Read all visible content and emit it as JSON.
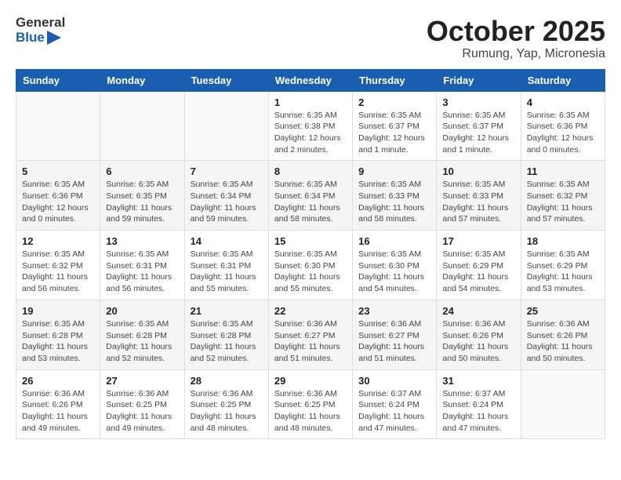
{
  "logo": {
    "text_general": "General",
    "text_blue": "Blue"
  },
  "title": {
    "month": "October 2025",
    "location": "Rumung, Yap, Micronesia"
  },
  "headers": [
    "Sunday",
    "Monday",
    "Tuesday",
    "Wednesday",
    "Thursday",
    "Friday",
    "Saturday"
  ],
  "weeks": [
    [
      {
        "day": "",
        "info": ""
      },
      {
        "day": "",
        "info": ""
      },
      {
        "day": "",
        "info": ""
      },
      {
        "day": "1",
        "info": "Sunrise: 6:35 AM\nSunset: 6:38 PM\nDaylight: 12 hours\nand 2 minutes."
      },
      {
        "day": "2",
        "info": "Sunrise: 6:35 AM\nSunset: 6:37 PM\nDaylight: 12 hours\nand 1 minute."
      },
      {
        "day": "3",
        "info": "Sunrise: 6:35 AM\nSunset: 6:37 PM\nDaylight: 12 hours\nand 1 minute."
      },
      {
        "day": "4",
        "info": "Sunrise: 6:35 AM\nSunset: 6:36 PM\nDaylight: 12 hours\nand 0 minutes."
      }
    ],
    [
      {
        "day": "5",
        "info": "Sunrise: 6:35 AM\nSunset: 6:36 PM\nDaylight: 12 hours\nand 0 minutes."
      },
      {
        "day": "6",
        "info": "Sunrise: 6:35 AM\nSunset: 6:35 PM\nDaylight: 11 hours\nand 59 minutes."
      },
      {
        "day": "7",
        "info": "Sunrise: 6:35 AM\nSunset: 6:34 PM\nDaylight: 11 hours\nand 59 minutes."
      },
      {
        "day": "8",
        "info": "Sunrise: 6:35 AM\nSunset: 6:34 PM\nDaylight: 11 hours\nand 58 minutes."
      },
      {
        "day": "9",
        "info": "Sunrise: 6:35 AM\nSunset: 6:33 PM\nDaylight: 11 hours\nand 58 minutes."
      },
      {
        "day": "10",
        "info": "Sunrise: 6:35 AM\nSunset: 6:33 PM\nDaylight: 11 hours\nand 57 minutes."
      },
      {
        "day": "11",
        "info": "Sunrise: 6:35 AM\nSunset: 6:32 PM\nDaylight: 11 hours\nand 57 minutes."
      }
    ],
    [
      {
        "day": "12",
        "info": "Sunrise: 6:35 AM\nSunset: 6:32 PM\nDaylight: 11 hours\nand 56 minutes."
      },
      {
        "day": "13",
        "info": "Sunrise: 6:35 AM\nSunset: 6:31 PM\nDaylight: 11 hours\nand 56 minutes."
      },
      {
        "day": "14",
        "info": "Sunrise: 6:35 AM\nSunset: 6:31 PM\nDaylight: 11 hours\nand 55 minutes."
      },
      {
        "day": "15",
        "info": "Sunrise: 6:35 AM\nSunset: 6:30 PM\nDaylight: 11 hours\nand 55 minutes."
      },
      {
        "day": "16",
        "info": "Sunrise: 6:35 AM\nSunset: 6:30 PM\nDaylight: 11 hours\nand 54 minutes."
      },
      {
        "day": "17",
        "info": "Sunrise: 6:35 AM\nSunset: 6:29 PM\nDaylight: 11 hours\nand 54 minutes."
      },
      {
        "day": "18",
        "info": "Sunrise: 6:35 AM\nSunset: 6:29 PM\nDaylight: 11 hours\nand 53 minutes."
      }
    ],
    [
      {
        "day": "19",
        "info": "Sunrise: 6:35 AM\nSunset: 6:28 PM\nDaylight: 11 hours\nand 53 minutes."
      },
      {
        "day": "20",
        "info": "Sunrise: 6:35 AM\nSunset: 6:28 PM\nDaylight: 11 hours\nand 52 minutes."
      },
      {
        "day": "21",
        "info": "Sunrise: 6:35 AM\nSunset: 6:28 PM\nDaylight: 11 hours\nand 52 minutes."
      },
      {
        "day": "22",
        "info": "Sunrise: 6:36 AM\nSunset: 6:27 PM\nDaylight: 11 hours\nand 51 minutes."
      },
      {
        "day": "23",
        "info": "Sunrise: 6:36 AM\nSunset: 6:27 PM\nDaylight: 11 hours\nand 51 minutes."
      },
      {
        "day": "24",
        "info": "Sunrise: 6:36 AM\nSunset: 6:26 PM\nDaylight: 11 hours\nand 50 minutes."
      },
      {
        "day": "25",
        "info": "Sunrise: 6:36 AM\nSunset: 6:26 PM\nDaylight: 11 hours\nand 50 minutes."
      }
    ],
    [
      {
        "day": "26",
        "info": "Sunrise: 6:36 AM\nSunset: 6:26 PM\nDaylight: 11 hours\nand 49 minutes."
      },
      {
        "day": "27",
        "info": "Sunrise: 6:36 AM\nSunset: 6:25 PM\nDaylight: 11 hours\nand 49 minutes."
      },
      {
        "day": "28",
        "info": "Sunrise: 6:36 AM\nSunset: 6:25 PM\nDaylight: 11 hours\nand 48 minutes."
      },
      {
        "day": "29",
        "info": "Sunrise: 6:36 AM\nSunset: 6:25 PM\nDaylight: 11 hours\nand 48 minutes."
      },
      {
        "day": "30",
        "info": "Sunrise: 6:37 AM\nSunset: 6:24 PM\nDaylight: 11 hours\nand 47 minutes."
      },
      {
        "day": "31",
        "info": "Sunrise: 6:37 AM\nSunset: 6:24 PM\nDaylight: 11 hours\nand 47 minutes."
      },
      {
        "day": "",
        "info": ""
      }
    ]
  ]
}
